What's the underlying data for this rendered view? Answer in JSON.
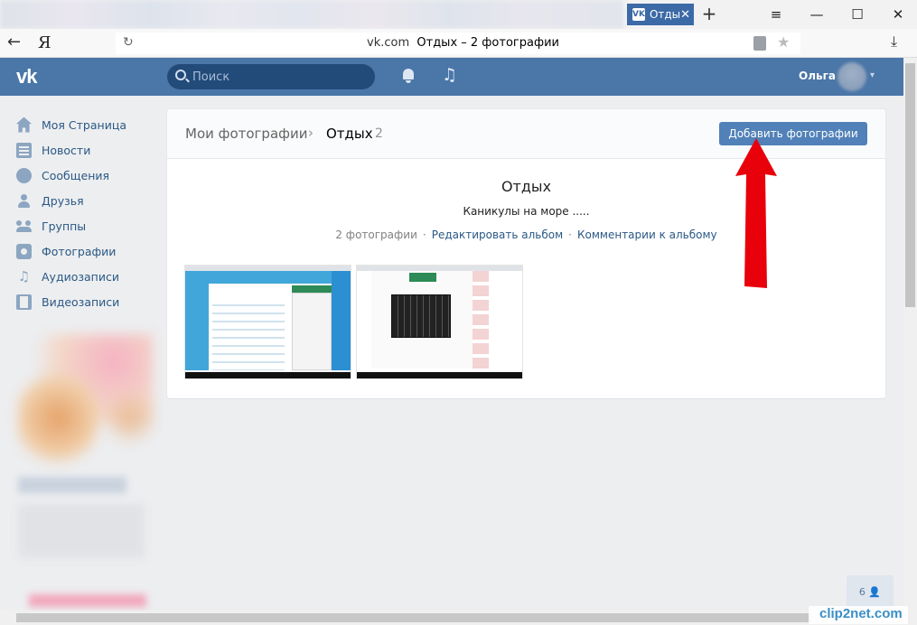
{
  "browser": {
    "active_tab_label": "Отды",
    "tab_vk_glyph": "VK",
    "tab_close": "✕",
    "new_tab": "+",
    "menu": "≡",
    "minimize": "—",
    "maximize": "☐",
    "close": "✕",
    "back": "←",
    "logo": "Я",
    "reload": "↻",
    "url_domain": "vk.com",
    "url_title": "Отдых – 2 фотографии",
    "star": "★",
    "download": "⤓"
  },
  "header": {
    "logo": "vk",
    "search_placeholder": "Поиск",
    "music_glyph": "♫",
    "user_name": "Ольга",
    "menu_chevron": "▾",
    "color": "#4a76a8"
  },
  "sidebar": {
    "items": [
      {
        "label": "Моя Страница",
        "icon": "home-icon"
      },
      {
        "label": "Новости",
        "icon": "news-icon"
      },
      {
        "label": "Сообщения",
        "icon": "messages-icon"
      },
      {
        "label": "Друзья",
        "icon": "friends-icon"
      },
      {
        "label": "Группы",
        "icon": "groups-icon"
      },
      {
        "label": "Фотографии",
        "icon": "photos-icon"
      },
      {
        "label": "Аудиозаписи",
        "icon": "audio-icon",
        "glyph": "♫"
      },
      {
        "label": "Видеозаписи",
        "icon": "video-icon"
      }
    ]
  },
  "album": {
    "breadcrumb_root": "Мои фотографии",
    "breadcrumb_sep": "›",
    "breadcrumb_current": "Отдых",
    "breadcrumb_count": "2",
    "add_button": "Добавить фотографии",
    "title": "Отдых",
    "description": "Каникулы на море .....",
    "photo_count": "2 фотографии",
    "separator": "·",
    "edit_link": "Редактировать альбом",
    "comments_link": "Комментарии к альбому",
    "button_color": "#5181b8"
  },
  "footer": {
    "online_count": "6 👤",
    "watermark": "clip2net.com"
  },
  "annotation": {
    "arrow_color": "#e8000b"
  }
}
